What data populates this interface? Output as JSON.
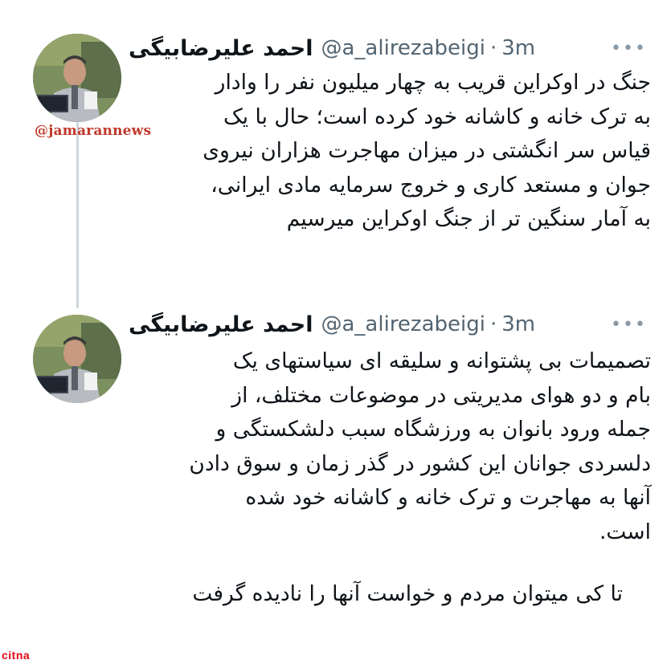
{
  "watermark": "@jamarannews",
  "site_logo": "citna",
  "tweets": [
    {
      "author": {
        "name": "احمد علیرضابیگی",
        "handle": "@a_alirezabeigi",
        "time": "3m"
      },
      "more_label": "•••",
      "lines": [
        "جنگ در اوکراین قریب به چهار میلیون نفر را  وادار",
        "به ترک خانه و کاشانه خود کرده است؛ حال با یک",
        "قیاس سر انگشتی در میزان مهاجرت هزاران نیروی",
        "جوان و مستعد کاری و خروج سرمایه مادی ایرانی،",
        "به آمار سنگین تر از جنگ اوکراین میرسیم"
      ]
    },
    {
      "author": {
        "name": "احمد علیرضابیگی",
        "handle": "@a_alirezabeigi",
        "time": "3m"
      },
      "more_label": "•••",
      "lines": [
        "تصمیمات بی پشتوانه و سلیقه ای سیاستهای یک",
        "بام و دو هوای مدیریتی در موضوعات مختلف، از",
        "جمله ورود بانوان به ورزشگاه سبب دلشکستگی و",
        "دلسردی جوانان این کشور در گذر زمان و سوق دادن",
        "آنها به مهاجرت و ترک خانه و کاشانه خود شده",
        "است."
      ],
      "closing_line": "تا کی میتوان مردم و خواست آنها را نادیده گرفت"
    }
  ]
}
